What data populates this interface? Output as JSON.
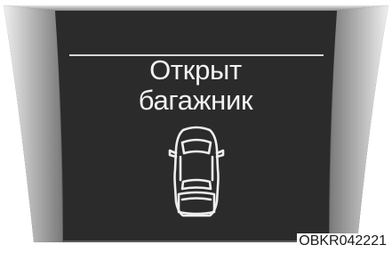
{
  "display": {
    "message_line1": "Открыт",
    "message_line2": "багажник",
    "icon": "car-trunk-open-icon"
  },
  "figure_code": "OBKR042221",
  "colors": {
    "screen": "#2b2b2b",
    "bezel_light": "#d7d7d7",
    "bezel_dark": "#6a6a6a",
    "text": "#f2f2f2"
  }
}
